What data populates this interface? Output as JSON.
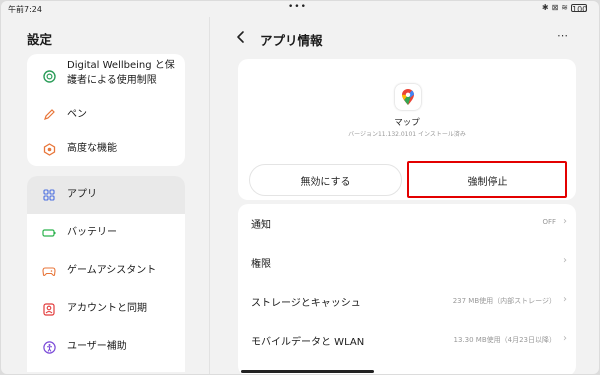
{
  "status_bar": {
    "time": "午前7:24",
    "dots": "•••",
    "bt": "✱",
    "sim": "⊠",
    "wifi": "≋",
    "battery": "100"
  },
  "sidebar": {
    "title": "設定",
    "items": [
      {
        "label": "Digital Wellbeing と保\n護者による使用制限",
        "icon": "digital-wellbeing-icon",
        "color": "#2e9e5b"
      },
      {
        "label": "ペン",
        "icon": "pen-icon",
        "color": "#e8763a"
      },
      {
        "label": "高度な機能",
        "icon": "advanced-features-icon",
        "color": "#e8763a"
      },
      {
        "label": "アプリ",
        "icon": "apps-grid-icon",
        "color": "#4a6ee0"
      },
      {
        "label": "バッテリー",
        "icon": "battery-icon",
        "color": "#2bb24c"
      },
      {
        "label": "ゲームアシスタント",
        "icon": "game-controller-icon",
        "color": "#e8763a"
      },
      {
        "label": "アカウントと同期",
        "icon": "account-icon",
        "color": "#e23b3b"
      },
      {
        "label": "ユーザー補助",
        "icon": "accessibility-icon",
        "color": "#7a4ad8"
      }
    ]
  },
  "header": {
    "title": "アプリ情報",
    "back_icon": "back-arrow-icon",
    "more": "⋯"
  },
  "app": {
    "name": "マップ",
    "version": "バージョン11.132.0101 インストール済み",
    "icon": "google-maps-icon"
  },
  "actions": {
    "disable_label": "無効にする",
    "force_stop_label": "強制停止"
  },
  "settings_rows": [
    {
      "label": "通知",
      "value": "OFF"
    },
    {
      "label": "権限",
      "value": ""
    },
    {
      "label": "ストレージとキャッシュ",
      "value": "237 MB使用（内部ストレージ）"
    },
    {
      "label": "モバイルデータと WLAN",
      "value": "13.30 MB使用（4月23日以降）"
    }
  ],
  "colors": {
    "highlight": "#e30000",
    "background": "#f2f2f2",
    "card": "#ffffff"
  }
}
